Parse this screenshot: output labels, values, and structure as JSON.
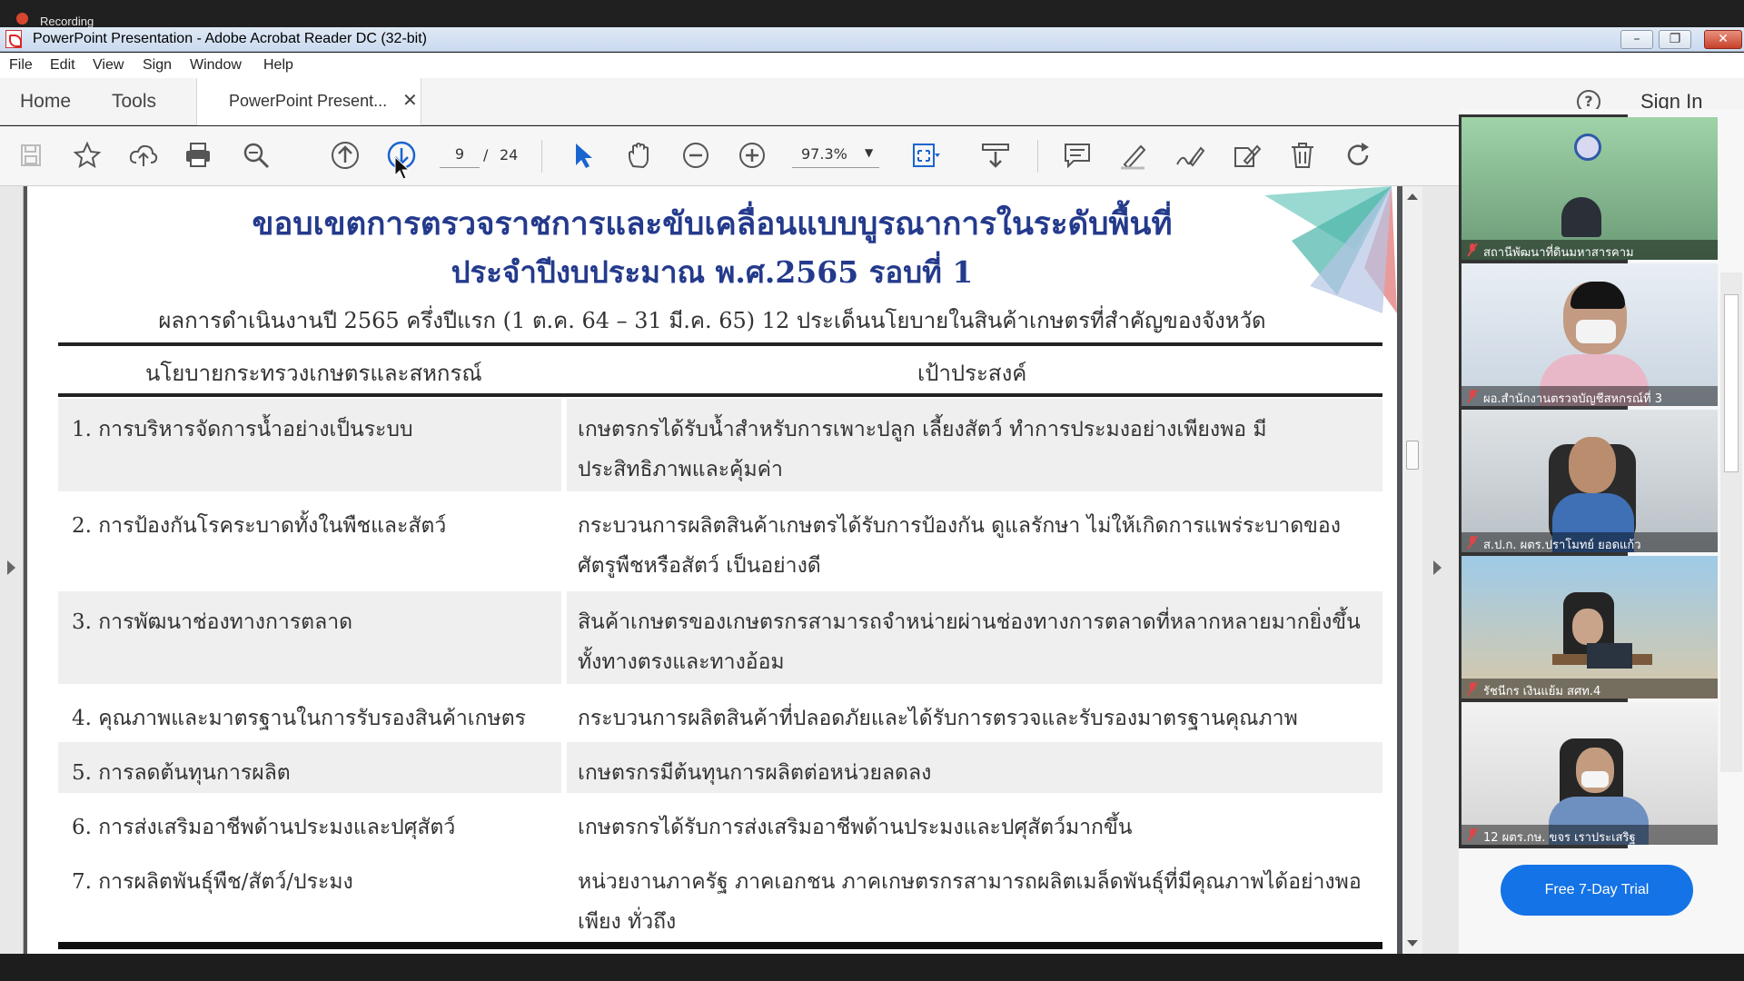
{
  "recording": {
    "label": "Recording"
  },
  "window": {
    "title": "PowerPoint Presentation - Adobe Acrobat Reader DC (32-bit)"
  },
  "menu": [
    "File",
    "Edit",
    "View",
    "Sign",
    "Window",
    "Help"
  ],
  "tabs": {
    "home": "Home",
    "tools": "Tools",
    "document": "PowerPoint Present...",
    "sign_in": "Sign In",
    "help_glyph": "?"
  },
  "toolbar": {
    "icons": [
      "save-icon",
      "bookmark-star-icon",
      "cloud-upload-icon",
      "print-icon",
      "search-zoom-icon",
      "previous-page-icon",
      "next-page-icon",
      "select-cursor-icon",
      "hand-tool-icon",
      "zoom-out-icon",
      "zoom-in-icon",
      "fit-page-icon",
      "scroll-mode-icon",
      "comment-icon",
      "highlight-pen-icon",
      "fill-sign-icon",
      "edit-pdf-icon",
      "delete-icon",
      "rotate-icon"
    ],
    "current_page": "9",
    "page_sep": "/",
    "total_pages": "24",
    "zoom": "97.3%"
  },
  "document": {
    "title_line1": "ขอบเขตการตรวจราชการและขับเคลื่อนแบบบูรณาการในระดับพื้นที่",
    "title_line2": "ประจำปีงบประมาณ พ.ศ.2565 รอบที่ 1",
    "subtitle": "ผลการดำเนินงานปี 2565 ครึ่งปีแรก (1 ต.ค. 64 – 31 มี.ค. 65) 12 ประเด็นนโยบายในสินค้าเกษตรที่สำคัญของจังหวัด",
    "col_policy": "นโยบายกระทรวงเกษตรและสหกรณ์",
    "col_goal": "เป้าประสงค์",
    "rows": [
      {
        "policy": "1. การบริหารจัดการน้ำอย่างเป็นระบบ",
        "goal": "เกษตรกรได้รับน้ำสำหรับการเพาะปลูก เลี้ยงสัตว์ ทำการประมงอย่างเพียงพอ มีประสิทธิภาพและคุ้มค่า"
      },
      {
        "policy": "2. การป้องกันโรคระบาดทั้งในพืชและสัตว์",
        "goal": "กระบวนการผลิตสินค้าเกษตรได้รับการป้องกัน ดูแลรักษา ไม่ให้เกิดการแพร่ระบาดของศัตรูพืชหรือสัตว์ เป็นอย่างดี"
      },
      {
        "policy": "3. การพัฒนาช่องทางการตลาด",
        "goal": "สินค้าเกษตรของเกษตรกรสามารถจำหน่ายผ่านช่องทางการตลาดที่หลากหลายมากยิ่งขึ้นทั้งทางตรงและทางอ้อม"
      },
      {
        "policy": "4. คุณภาพและมาตรฐานในการรับรองสินค้าเกษตร",
        "goal": "กระบวนการผลิตสินค้าที่ปลอดภัยและได้รับการตรวจและรับรองมาตรฐานคุณภาพ"
      },
      {
        "policy": "5. การลดต้นทุนการผลิต",
        "goal": "เกษตรกรมีต้นทุนการผลิตต่อหน่วยลดลง"
      },
      {
        "policy": "6. การส่งเสริมอาชีพด้านประมงและปศุสัตว์",
        "goal": "เกษตรกรได้รับการส่งเสริมอาชีพด้านประมงและปศุสัตว์มากขึ้น"
      },
      {
        "policy": "7. การผลิตพันธุ์พืช/สัตว์/ประมง",
        "goal": "หน่วยงานภาครัฐ ภาคเอกชน ภาคเกษตรกรสามารถผลิตเมล็ดพันธุ์ที่มีคุณภาพได้อย่างพอเพียง ทั่วถึง"
      }
    ]
  },
  "participants": [
    {
      "name": "สถานีพัฒนาที่ดินมหาสารคาม"
    },
    {
      "name": "ผอ.สำนักงานตรวจบัญชีสหกรณ์ที่ 3"
    },
    {
      "name": "ส.ป.ก. ผตร.ปราโมทย์ ยอดแก้ว"
    },
    {
      "name": "รัชนีกร เงินแย้ม สศท.4"
    },
    {
      "name": "12 ผตร.กษ. ขจร เราประเสริฐ"
    }
  ],
  "trial_button": "Free 7-Day Trial",
  "colors": {
    "title_blue": "#243a8c",
    "trial_blue": "#1473e6",
    "icon_blue": "#1a64d0"
  }
}
